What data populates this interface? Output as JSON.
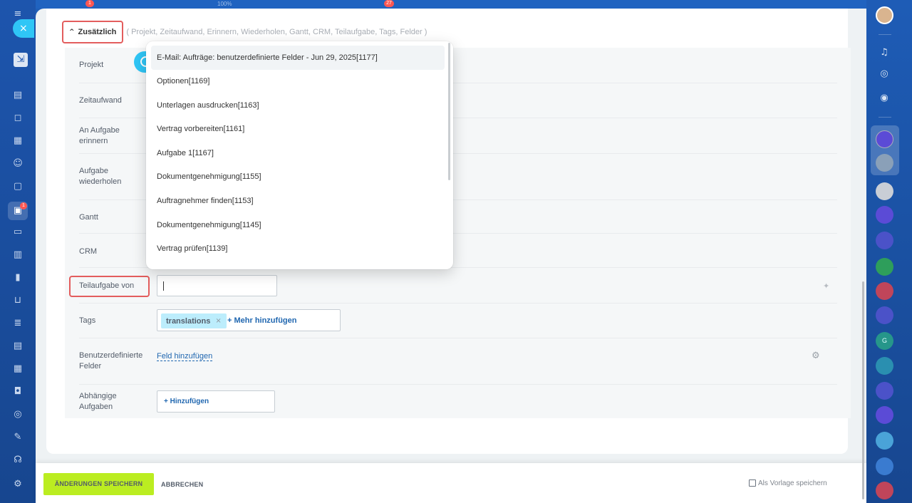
{
  "top_strip": {
    "badge_left": "1",
    "zoom": "100%",
    "badge_right": "27"
  },
  "left_bar": {
    "close_icon": "×",
    "icons": [
      "menu-icon",
      "collapse-icon",
      "feed-icon",
      "tasks-icon",
      "chat-icon",
      "calendar-icon",
      "contacts-icon",
      "docs-icon",
      "task-inbox-icon",
      "drive-icon",
      "webinar-icon",
      "analytics-icon",
      "shop-icon",
      "sales-icon",
      "crm-icon",
      "planner-icon",
      "robot-icon",
      "goals-icon",
      "sign-icon",
      "support-icon",
      "settings-icon"
    ],
    "badge": "1"
  },
  "extra": {
    "toggle_label": "Zusätzlich",
    "field_list": "( Projekt,  Zeitaufwand,  Erinnern,  Wiederholen,  Gantt,  CRM,  Teilaufgabe,  Tags,  Felder )"
  },
  "rows": {
    "project": "Projekt",
    "time": "Zeitaufwand",
    "remind": "An Aufgabe erinnern",
    "repeat": "Aufgabe wiederholen",
    "gantt": "Gantt",
    "crm": "CRM",
    "subtask": "Teilaufgabe von",
    "tags": "Tags",
    "custom": "Benutzerdefinierte Felder",
    "dependent": "Abhängige Aufgaben"
  },
  "tags": {
    "chip": "translations",
    "chip_remove": "×",
    "add": "+ Mehr hinzufügen"
  },
  "custom_fields": {
    "add_link": "Feld hinzufügen"
  },
  "dependent": {
    "add": "+ Hinzufügen"
  },
  "dropdown": {
    "items": [
      "E-Mail: Aufträge: benutzerdefinierte Felder - Jun 29, 2025[1177]",
      "Optionen[1169]",
      "Unterlagen ausdrucken[1163]",
      "Vertrag vorbereiten[1161]",
      "Aufgabe 1[1167]",
      "Dokumentgenehmigung[1155]",
      "Auftragnehmer finden[1153]",
      "Dokumentgenehmigung[1145]",
      "Vertrag prüfen[1139]"
    ]
  },
  "footer": {
    "save": "ÄNDERUNGEN SPEICHERN",
    "cancel": "ABBRECHEN",
    "template": "Als Vorlage speichern"
  },
  "right_bar": {
    "avatar_letter_g": "G"
  },
  "colors": {
    "accent_blue": "#2fc6f6",
    "save_green": "#bbed21",
    "highlight_red": "#e35d5d",
    "link_blue": "#2067b0",
    "tag_chip": "#bcedfc"
  }
}
